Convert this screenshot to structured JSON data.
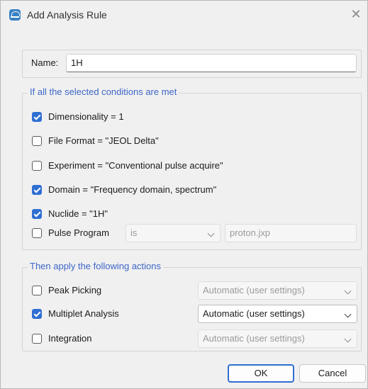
{
  "window": {
    "title": "Add Analysis Rule"
  },
  "name_field": {
    "label": "Name:",
    "value": "1H"
  },
  "conditions": {
    "legend": "If all the selected conditions are met",
    "items": [
      {
        "label": "Dimensionality = 1",
        "checked": true
      },
      {
        "label": "File Format = \"JEOL Delta\"",
        "checked": false
      },
      {
        "label": "Experiment = \"Conventional pulse acquire\"",
        "checked": false
      },
      {
        "label": "Domain = \"Frequency domain, spectrum\"",
        "checked": true
      },
      {
        "label": "Nuclide = \"1H\"",
        "checked": true
      }
    ],
    "pulse_program": {
      "label": "Pulse Program",
      "checked": false,
      "operator": "is",
      "value": "proton.jxp"
    }
  },
  "actions": {
    "legend": "Then apply the following actions",
    "items": [
      {
        "label": "Peak Picking",
        "checked": false,
        "option": "Automatic (user settings)"
      },
      {
        "label": "Multiplet Analysis",
        "checked": true,
        "option": "Automatic (user settings)"
      },
      {
        "label": "Integration",
        "checked": false,
        "option": "Automatic (user settings)"
      }
    ]
  },
  "buttons": {
    "ok": "OK",
    "cancel": "Cancel"
  },
  "colors": {
    "accent": "#2f6fd2",
    "legend_text": "#3d66c7"
  }
}
